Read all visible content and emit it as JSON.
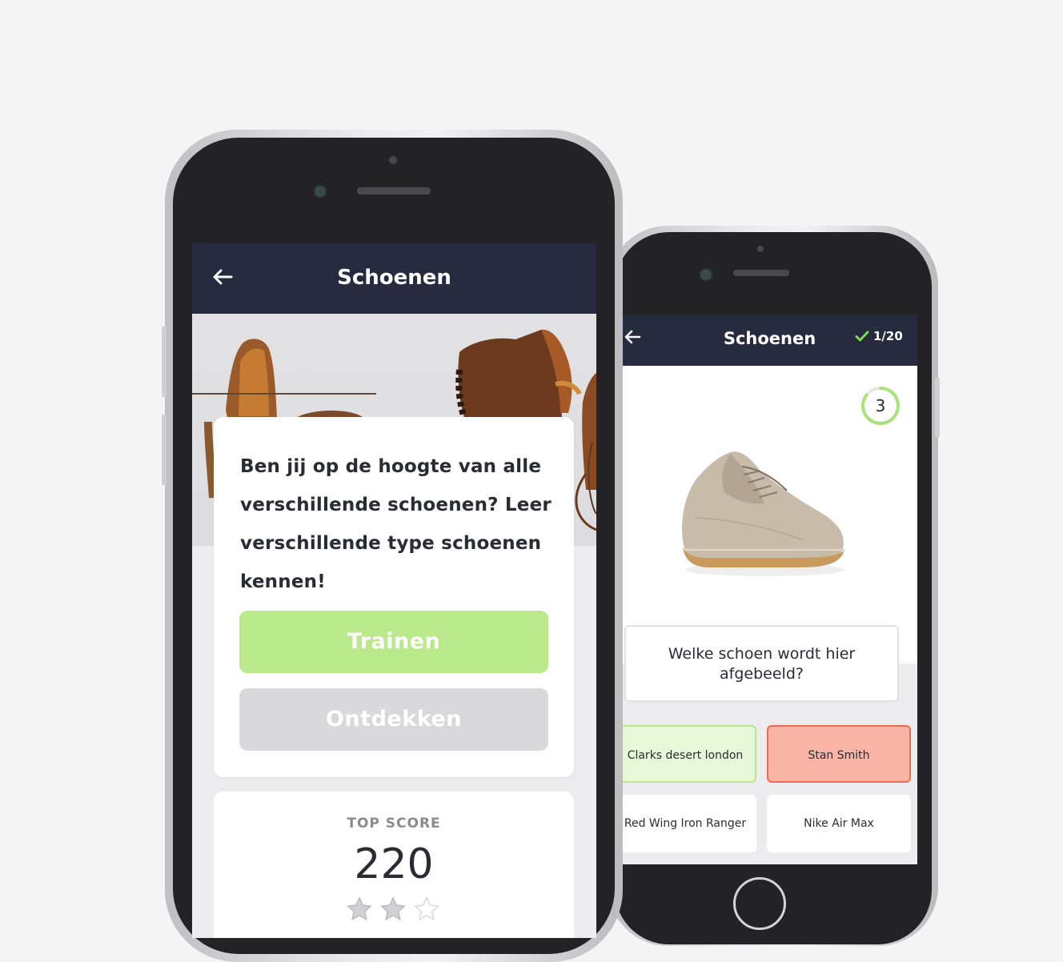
{
  "left_screen": {
    "header": {
      "title": "Schoenen",
      "back_icon": "arrow-left-icon"
    },
    "intro_text": "Ben jij op de hoogte van alle verschillende schoenen? Leer verschillende type schoenen kennen!",
    "buttons": {
      "train_label": "Trainen",
      "discover_label": "Ontdekken"
    },
    "score": {
      "label": "TOP SCORE",
      "value": "220",
      "stars_filled": 2,
      "stars_total": 3
    },
    "colors": {
      "header": "#282a3f",
      "train": "#b9e98a",
      "discover": "#d9d9db"
    }
  },
  "right_screen": {
    "header": {
      "title": "Schoenen",
      "back_icon": "arrow-left-icon",
      "check_icon": "check-icon",
      "progress": "1/20"
    },
    "timer": "3",
    "question": "Welke schoen wordt hier afgebeeld?",
    "answers": [
      {
        "label": "Clarks desert london",
        "state": "correct"
      },
      {
        "label": "Stan Smith",
        "state": "wrong"
      },
      {
        "label": "Red Wing Iron Ranger",
        "state": "neutral"
      },
      {
        "label": "Nike Air Max",
        "state": "neutral"
      }
    ],
    "colors": {
      "correct_bg": "#e7f8d8",
      "correct_border": "#b8e68e",
      "wrong_bg": "#f8b4a4",
      "wrong_border": "#ef6a4f",
      "timer_ring": "#a8e27a"
    }
  }
}
